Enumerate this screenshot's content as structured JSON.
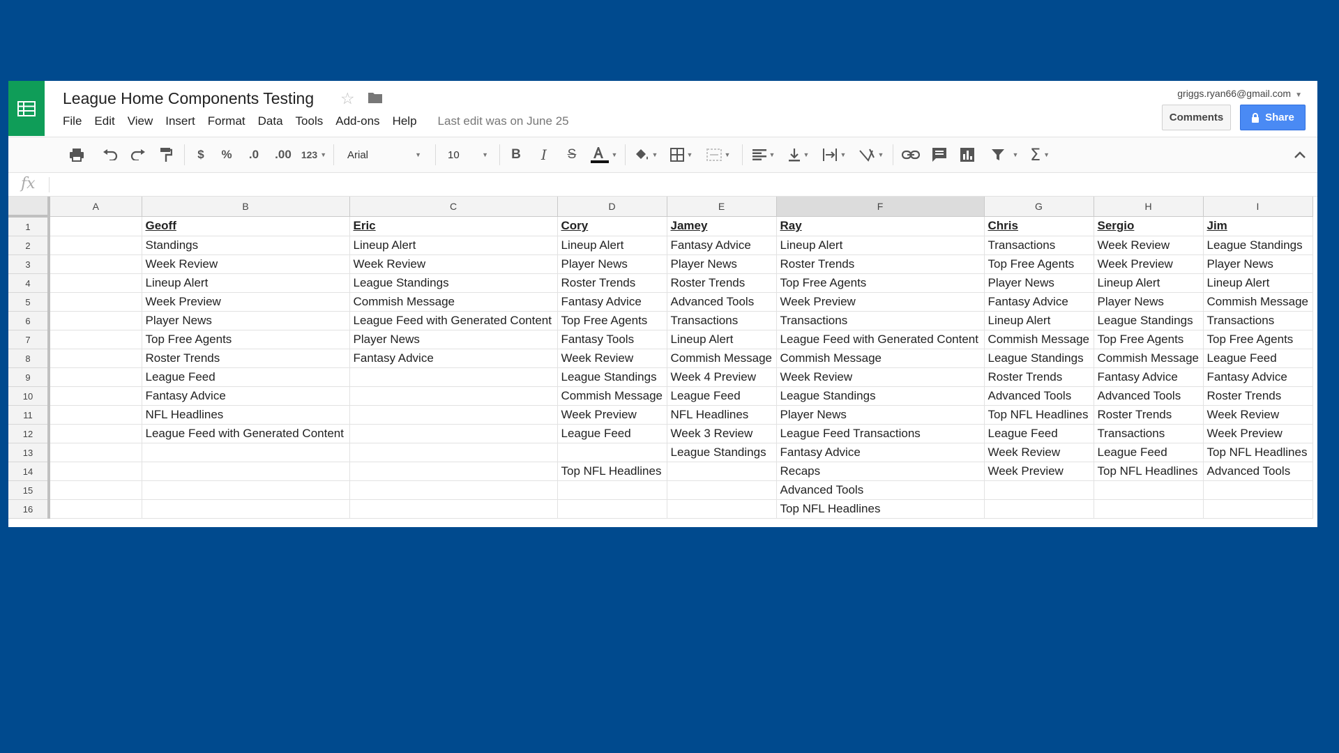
{
  "header": {
    "title": "League Home Components Testing",
    "menu": [
      "File",
      "Edit",
      "View",
      "Insert",
      "Format",
      "Data",
      "Tools",
      "Add-ons",
      "Help"
    ],
    "last_edit": "Last edit was on June 25",
    "account_email": "griggs.ryan66@gmail.com",
    "comments_label": "Comments",
    "share_label": "Share"
  },
  "toolbar": {
    "currency_label": "$",
    "percent_label": "%",
    "decrease_decimal_label": ".0",
    "increase_decimal_label": ".00",
    "more_formats_label": "123",
    "font_family": "Arial",
    "font_size": "10"
  },
  "colors": {
    "background": "#004a8e",
    "sheets_green": "#0f9d58",
    "share_blue": "#4a8af4"
  },
  "formula_bar": {
    "label": "fx",
    "value": ""
  },
  "sheet": {
    "selected_column": "F",
    "column_headers": [
      "A",
      "B",
      "C",
      "D",
      "E",
      "F",
      "G",
      "H",
      "I"
    ],
    "row_numbers": [
      "1",
      "2",
      "3",
      "4",
      "5",
      "6",
      "7",
      "8",
      "9",
      "10",
      "11",
      "12",
      "13",
      "14",
      "15",
      "16"
    ],
    "rows": [
      [
        "",
        "Geoff",
        "Eric",
        "Cory",
        "Jamey",
        "Ray",
        "Chris",
        "Sergio",
        "Jim"
      ],
      [
        "",
        "Standings",
        "Lineup Alert",
        "Lineup Alert",
        "Fantasy Advice",
        "Lineup Alert",
        "Transactions",
        "Week Review",
        "League Standings"
      ],
      [
        "",
        "Week Review",
        "Week Review",
        "Player News",
        "Player News",
        "Roster Trends",
        "Top Free Agents",
        "Week Preview",
        "Player News"
      ],
      [
        "",
        "Lineup Alert",
        "League Standings",
        "Roster Trends",
        "Roster Trends",
        "Top Free Agents",
        "Player News",
        "Lineup Alert",
        "Lineup Alert"
      ],
      [
        "",
        "Week Preview",
        "Commish Message",
        "Fantasy Advice",
        "Advanced Tools",
        "Week Preview",
        "Fantasy Advice",
        "Player News",
        "Commish Message"
      ],
      [
        "",
        "Player News",
        "League Feed with Generated Content",
        "Top Free Agents",
        "Transactions",
        "Transactions",
        "Lineup Alert",
        "League Standings",
        "Transactions"
      ],
      [
        "",
        "Top Free Agents",
        "Player News",
        "Fantasy Tools",
        "Lineup Alert",
        "League Feed with Generated Content",
        "Commish Message",
        "Top Free Agents",
        "Top Free Agents"
      ],
      [
        "",
        "Roster Trends",
        "Fantasy Advice",
        "Week Review",
        "Commish Message",
        "Commish Message",
        "League Standings",
        "Commish Message",
        "League Feed"
      ],
      [
        "",
        "League Feed",
        "",
        "League Standings",
        "Week 4 Preview",
        "Week Review",
        "Roster Trends",
        "Fantasy Advice",
        "Fantasy Advice"
      ],
      [
        "",
        "Fantasy Advice",
        "",
        "Commish Message",
        "League Feed",
        "League Standings",
        "Advanced Tools",
        "Advanced Tools",
        "Roster Trends"
      ],
      [
        "",
        "NFL Headlines",
        "",
        "Week Preview",
        "NFL Headlines",
        "Player News",
        "Top NFL Headlines",
        "Roster Trends",
        "Week Review"
      ],
      [
        "",
        "League Feed with Generated Content",
        "",
        "League Feed",
        "Week 3 Review",
        "League Feed Transactions",
        "League Feed",
        "Transactions",
        "Week Preview"
      ],
      [
        "",
        "",
        "",
        "",
        "League Standings",
        "Fantasy Advice",
        "Week Review",
        "League Feed",
        "Top NFL Headlines"
      ],
      [
        "",
        "",
        "",
        "Top NFL Headlines",
        "",
        "Recaps",
        "Week Preview",
        "Top NFL Headlines",
        "Advanced Tools"
      ],
      [
        "",
        "",
        "",
        "",
        "",
        "Advanced Tools",
        "",
        "",
        ""
      ],
      [
        "",
        "",
        "",
        "",
        "",
        "Top NFL Headlines",
        "",
        "",
        ""
      ]
    ]
  }
}
